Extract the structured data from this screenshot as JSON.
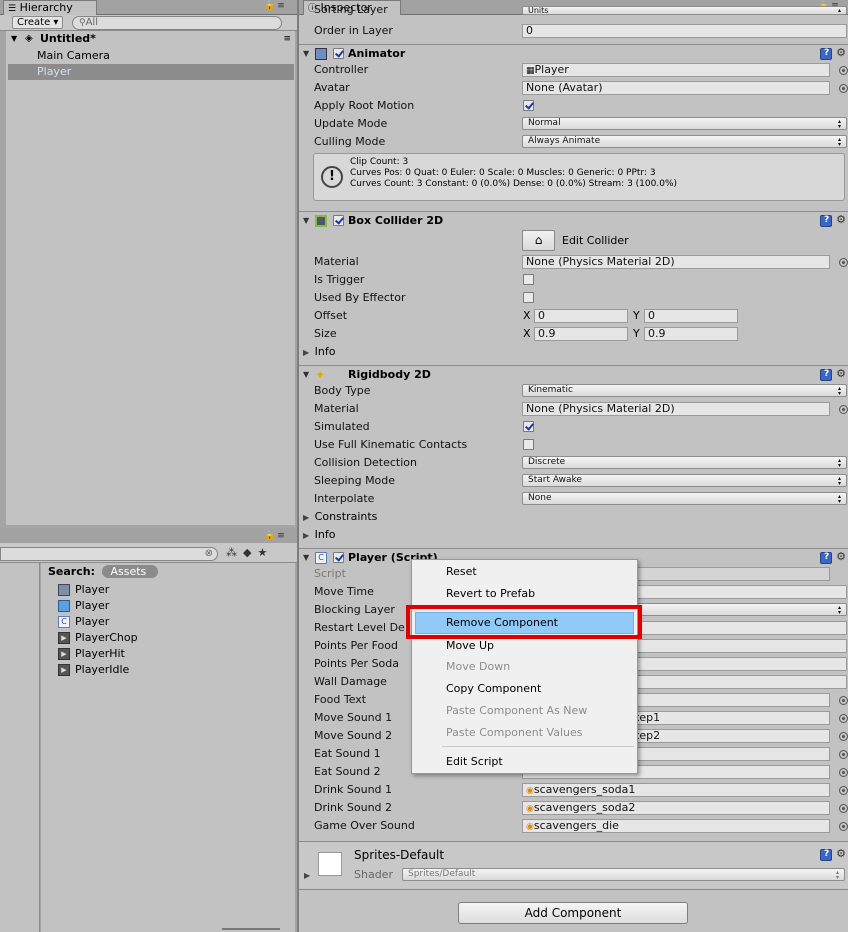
{
  "hierarchy": {
    "tab_label": "Hierarchy",
    "create_label": "Create ▾",
    "search_placeholder": "All",
    "scene_name": "Untitled*",
    "items": [
      {
        "label": "Main Camera"
      },
      {
        "label": "Player"
      }
    ]
  },
  "project": {
    "search_label": "Search:",
    "assets_chip": "Assets",
    "items": [
      {
        "label": "Player",
        "icon": "animator-controller-icon"
      },
      {
        "label": "Player",
        "icon": "prefab-cube-icon"
      },
      {
        "label": "Player",
        "icon": "csharp-script-icon"
      },
      {
        "label": "PlayerChop",
        "icon": "animation-clip-icon"
      },
      {
        "label": "PlayerHit",
        "icon": "animation-clip-icon"
      },
      {
        "label": "PlayerIdle",
        "icon": "animation-clip-icon"
      }
    ]
  },
  "inspector": {
    "tab_label": "Inspector",
    "top": {
      "sorting_layer_label": "Sorting Layer",
      "sorting_layer_value": "Units",
      "order_label": "Order in Layer",
      "order_value": "0"
    },
    "animator": {
      "title": "Animator",
      "controller_label": "Controller",
      "controller_value": "Player",
      "avatar_label": "Avatar",
      "avatar_value": "None (Avatar)",
      "root_motion_label": "Apply Root Motion",
      "update_mode_label": "Update Mode",
      "update_mode_value": "Normal",
      "culling_label": "Culling Mode",
      "culling_value": "Always Animate",
      "info_line1": "Clip Count: 3",
      "info_line2": "Curves Pos: 0 Quat: 0 Euler: 0 Scale: 0 Muscles: 0 Generic: 0 PPtr: 3",
      "info_line3": "Curves Count: 3 Constant: 0 (0.0%) Dense: 0 (0.0%) Stream: 3 (100.0%)"
    },
    "box_collider": {
      "title": "Box Collider 2D",
      "edit_label": "Edit Collider",
      "material_label": "Material",
      "material_value": "None (Physics Material 2D)",
      "trigger_label": "Is Trigger",
      "effector_label": "Used By Effector",
      "offset_label": "Offset",
      "offset_x": "0",
      "offset_y": "0",
      "size_label": "Size",
      "size_x": "0.9",
      "size_y": "0.9",
      "x": "X",
      "y": "Y",
      "info_label": "Info"
    },
    "rigidbody": {
      "title": "Rigidbody 2D",
      "body_type_label": "Body Type",
      "body_type_value": "Kinematic",
      "material_label": "Material",
      "material_value": "None (Physics Material 2D)",
      "simulated_label": "Simulated",
      "full_kin_label": "Use Full Kinematic Contacts",
      "collision_label": "Collision Detection",
      "collision_value": "Discrete",
      "sleeping_label": "Sleeping Mode",
      "sleeping_value": "Start Awake",
      "interpolate_label": "Interpolate",
      "interpolate_value": "None",
      "constraints_label": "Constraints",
      "info_label": "Info"
    },
    "player_script": {
      "title": "Player (Script)",
      "script_label": "Script",
      "move_time_label": "Move Time",
      "blocking_label": "Blocking Layer",
      "restart_label": "Restart Level De",
      "points_food_label": "Points Per Food",
      "points_soda_label": "Points Per Soda",
      "wall_damage_label": "Wall Damage",
      "food_text_label": "Food Text",
      "move1_label": "Move Sound 1",
      "move1_value": "tep1",
      "move2_label": "Move Sound 2",
      "move2_value": "tep2",
      "eat1_label": "Eat Sound 1",
      "eat2_label": "Eat Sound 2",
      "drink1_label": "Drink Sound 1",
      "drink1_value": "scavengers_soda1",
      "drink2_label": "Drink Sound 2",
      "drink2_value": "scavengers_soda2",
      "gameover_label": "Game Over Sound",
      "gameover_value": "scavengers_die"
    },
    "material": {
      "name": "Sprites-Default",
      "shader_label": "Shader",
      "shader_value": "Sprites/Default"
    },
    "add_component_label": "Add Component"
  },
  "context_menu": {
    "items": [
      {
        "label": "Reset",
        "enabled": true
      },
      {
        "label": "Revert to Prefab",
        "enabled": true
      },
      {
        "label": "Remove Component",
        "enabled": true,
        "highlighted": true
      },
      {
        "label": "Move Up",
        "enabled": true
      },
      {
        "label": "Move Down",
        "enabled": false
      },
      {
        "label": "Copy Component",
        "enabled": true
      },
      {
        "label": "Paste Component As New",
        "enabled": false
      },
      {
        "label": "Paste Component Values",
        "enabled": false
      },
      {
        "label": "Edit Script",
        "enabled": true
      }
    ]
  },
  "colors": {
    "selection": "#8c8c8c",
    "menu_highlight": "#91c9f7",
    "annotation_red": "#e00000"
  }
}
